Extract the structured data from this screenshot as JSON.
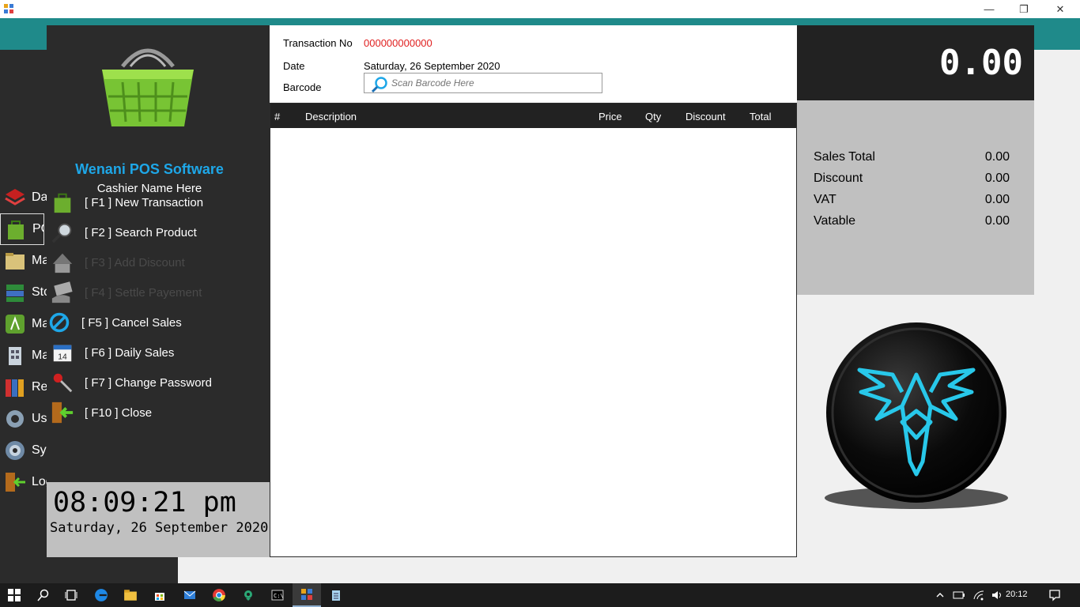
{
  "window": {
    "minimize": "—",
    "restore": "❐",
    "close": "✕"
  },
  "main_sidebar": {
    "items": [
      {
        "label": "Dashboard",
        "icon": "layers-icon"
      },
      {
        "label": "POS",
        "icon": "shopping-bag-icon"
      },
      {
        "label": "Manage",
        "icon": "folder-icon"
      },
      {
        "label": "Stock",
        "icon": "books-icon"
      },
      {
        "label": "Manage",
        "icon": "app-icon"
      },
      {
        "label": "Manage",
        "icon": "building-icon"
      },
      {
        "label": "Reports",
        "icon": "binders-icon"
      },
      {
        "label": "Users",
        "icon": "gear-icon"
      },
      {
        "label": "System",
        "icon": "settings-icon"
      },
      {
        "label": "Logout",
        "icon": "exit-door-icon"
      }
    ]
  },
  "pos": {
    "brand": "Wenani POS Software",
    "cashier": "Cashier Name Here",
    "menu": [
      {
        "label": "[ F1 ] New Transaction",
        "enabled": true
      },
      {
        "label": "[ F2 ] Search Product",
        "enabled": true
      },
      {
        "label": "[ F3 ] Add Discount",
        "enabled": false
      },
      {
        "label": "[ F4 ] Settle Payement",
        "enabled": false
      },
      {
        "label": "[ F5 ] Cancel Sales",
        "enabled": true
      },
      {
        "label": "[ F6 ] Daily Sales",
        "enabled": true
      },
      {
        "label": "[ F7 ] Change Password",
        "enabled": true
      },
      {
        "label": "[ F10 ] Close",
        "enabled": true
      }
    ],
    "clock_time": "08:09:21 pm",
    "clock_date": "Saturday, 26 September 2020"
  },
  "header": {
    "transaction_label": "Transaction No",
    "transaction_value": "000000000000",
    "date_label": "Date",
    "date_value": "Saturday, 26 September 2020",
    "barcode_label": "Barcode",
    "barcode_placeholder": "Scan Barcode Here"
  },
  "grid": {
    "columns": [
      "#",
      "Description",
      "Price",
      "Qty",
      "Discount",
      "Total"
    ],
    "rows": []
  },
  "totals": {
    "display": "0.00",
    "rows": [
      {
        "label": "Sales Total",
        "value": "0.00"
      },
      {
        "label": "Discount",
        "value": "0.00"
      },
      {
        "label": "VAT",
        "value": "0.00"
      },
      {
        "label": "Vatable",
        "value": "0.00"
      }
    ]
  },
  "taskbar": {
    "time": "20:12",
    "icons": [
      "windows-start-icon",
      "search-icon",
      "task-view-icon",
      "edge-icon",
      "file-explorer-icon",
      "store-icon",
      "mail-icon",
      "chrome-icon",
      "maps-icon",
      "terminal-icon",
      "pos-app-icon",
      "notepad-icon"
    ]
  },
  "colors": {
    "accent": "#1ea7e8",
    "teal": "#1f8a8a",
    "panel_dark": "#2b2b2b",
    "error_red": "#e02020"
  }
}
